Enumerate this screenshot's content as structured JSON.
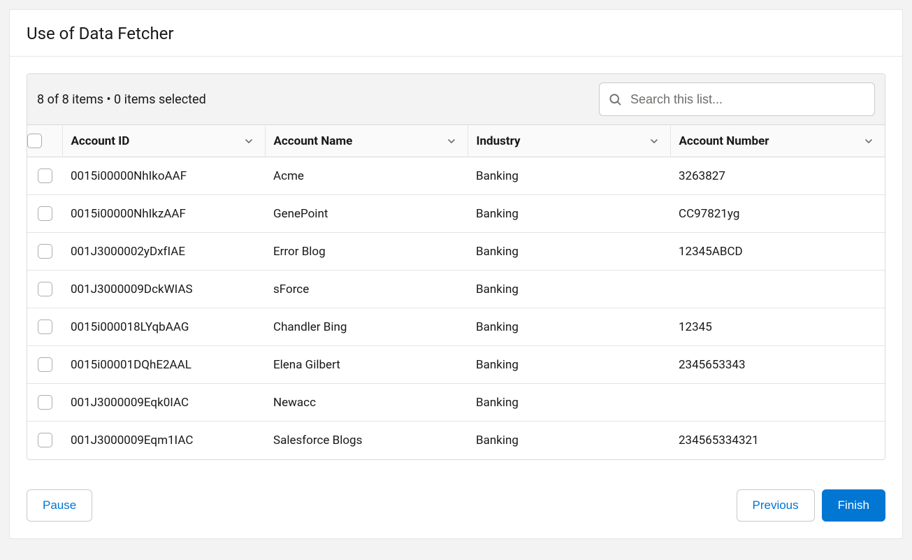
{
  "header": {
    "title": "Use of Data Fetcher"
  },
  "toolbar": {
    "status": "8 of 8 items • 0 items selected",
    "search_placeholder": "Search this list..."
  },
  "table": {
    "columns": [
      {
        "label": "Account ID"
      },
      {
        "label": "Account Name"
      },
      {
        "label": "Industry"
      },
      {
        "label": "Account Number"
      }
    ],
    "rows": [
      {
        "id": "0015i00000NhIkoAAF",
        "name": "Acme",
        "industry": "Banking",
        "number": "3263827"
      },
      {
        "id": "0015i00000NhIkzAAF",
        "name": "GenePoint",
        "industry": "Banking",
        "number": "CC97821yg"
      },
      {
        "id": "001J3000002yDxfIAE",
        "name": "Error Blog",
        "industry": "Banking",
        "number": "12345ABCD"
      },
      {
        "id": "001J3000009DckWIAS",
        "name": "sForce",
        "industry": "Banking",
        "number": ""
      },
      {
        "id": "0015i000018LYqbAAG",
        "name": "Chandler Bing",
        "industry": "Banking",
        "number": "12345"
      },
      {
        "id": "0015i00001DQhE2AAL",
        "name": "Elena Gilbert",
        "industry": "Banking",
        "number": "2345653343"
      },
      {
        "id": "001J3000009Eqk0IAC",
        "name": "Newacc",
        "industry": "Banking",
        "number": ""
      },
      {
        "id": "001J3000009Eqm1IAC",
        "name": "Salesforce Blogs",
        "industry": "Banking",
        "number": "234565334321"
      }
    ]
  },
  "footer": {
    "pause": "Pause",
    "previous": "Previous",
    "finish": "Finish"
  }
}
